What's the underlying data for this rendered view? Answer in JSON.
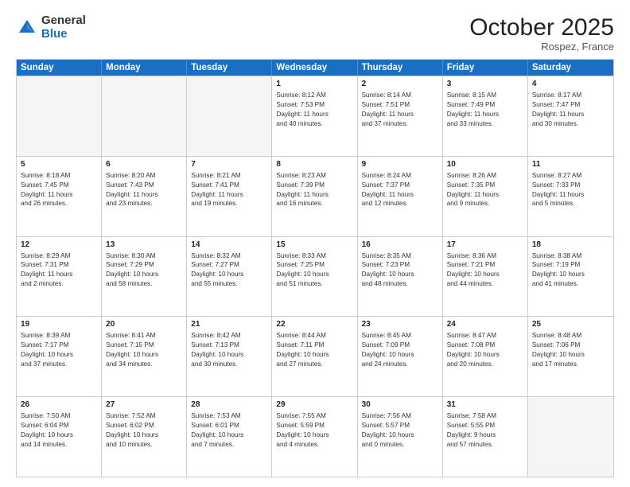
{
  "logo": {
    "general": "General",
    "blue": "Blue"
  },
  "title": "October 2025",
  "location": "Rospez, France",
  "header_days": [
    "Sunday",
    "Monday",
    "Tuesday",
    "Wednesday",
    "Thursday",
    "Friday",
    "Saturday"
  ],
  "weeks": [
    [
      {
        "day": "",
        "empty": true
      },
      {
        "day": "",
        "empty": true
      },
      {
        "day": "",
        "empty": true
      },
      {
        "day": "1",
        "lines": [
          "Sunrise: 8:12 AM",
          "Sunset: 7:53 PM",
          "Daylight: 11 hours",
          "and 40 minutes."
        ]
      },
      {
        "day": "2",
        "lines": [
          "Sunrise: 8:14 AM",
          "Sunset: 7:51 PM",
          "Daylight: 11 hours",
          "and 37 minutes."
        ]
      },
      {
        "day": "3",
        "lines": [
          "Sunrise: 8:15 AM",
          "Sunset: 7:49 PM",
          "Daylight: 11 hours",
          "and 33 minutes."
        ]
      },
      {
        "day": "4",
        "lines": [
          "Sunrise: 8:17 AM",
          "Sunset: 7:47 PM",
          "Daylight: 11 hours",
          "and 30 minutes."
        ]
      }
    ],
    [
      {
        "day": "5",
        "lines": [
          "Sunrise: 8:18 AM",
          "Sunset: 7:45 PM",
          "Daylight: 11 hours",
          "and 26 minutes."
        ]
      },
      {
        "day": "6",
        "lines": [
          "Sunrise: 8:20 AM",
          "Sunset: 7:43 PM",
          "Daylight: 11 hours",
          "and 23 minutes."
        ]
      },
      {
        "day": "7",
        "lines": [
          "Sunrise: 8:21 AM",
          "Sunset: 7:41 PM",
          "Daylight: 11 hours",
          "and 19 minutes."
        ]
      },
      {
        "day": "8",
        "lines": [
          "Sunrise: 8:23 AM",
          "Sunset: 7:39 PM",
          "Daylight: 11 hours",
          "and 16 minutes."
        ]
      },
      {
        "day": "9",
        "lines": [
          "Sunrise: 8:24 AM",
          "Sunset: 7:37 PM",
          "Daylight: 11 hours",
          "and 12 minutes."
        ]
      },
      {
        "day": "10",
        "lines": [
          "Sunrise: 8:26 AM",
          "Sunset: 7:35 PM",
          "Daylight: 11 hours",
          "and 9 minutes."
        ]
      },
      {
        "day": "11",
        "lines": [
          "Sunrise: 8:27 AM",
          "Sunset: 7:33 PM",
          "Daylight: 11 hours",
          "and 5 minutes."
        ]
      }
    ],
    [
      {
        "day": "12",
        "lines": [
          "Sunrise: 8:29 AM",
          "Sunset: 7:31 PM",
          "Daylight: 11 hours",
          "and 2 minutes."
        ]
      },
      {
        "day": "13",
        "lines": [
          "Sunrise: 8:30 AM",
          "Sunset: 7:29 PM",
          "Daylight: 10 hours",
          "and 58 minutes."
        ]
      },
      {
        "day": "14",
        "lines": [
          "Sunrise: 8:32 AM",
          "Sunset: 7:27 PM",
          "Daylight: 10 hours",
          "and 55 minutes."
        ]
      },
      {
        "day": "15",
        "lines": [
          "Sunrise: 8:33 AM",
          "Sunset: 7:25 PM",
          "Daylight: 10 hours",
          "and 51 minutes."
        ]
      },
      {
        "day": "16",
        "lines": [
          "Sunrise: 8:35 AM",
          "Sunset: 7:23 PM",
          "Daylight: 10 hours",
          "and 48 minutes."
        ]
      },
      {
        "day": "17",
        "lines": [
          "Sunrise: 8:36 AM",
          "Sunset: 7:21 PM",
          "Daylight: 10 hours",
          "and 44 minutes."
        ]
      },
      {
        "day": "18",
        "lines": [
          "Sunrise: 8:38 AM",
          "Sunset: 7:19 PM",
          "Daylight: 10 hours",
          "and 41 minutes."
        ]
      }
    ],
    [
      {
        "day": "19",
        "lines": [
          "Sunrise: 8:39 AM",
          "Sunset: 7:17 PM",
          "Daylight: 10 hours",
          "and 37 minutes."
        ]
      },
      {
        "day": "20",
        "lines": [
          "Sunrise: 8:41 AM",
          "Sunset: 7:15 PM",
          "Daylight: 10 hours",
          "and 34 minutes."
        ]
      },
      {
        "day": "21",
        "lines": [
          "Sunrise: 8:42 AM",
          "Sunset: 7:13 PM",
          "Daylight: 10 hours",
          "and 30 minutes."
        ]
      },
      {
        "day": "22",
        "lines": [
          "Sunrise: 8:44 AM",
          "Sunset: 7:11 PM",
          "Daylight: 10 hours",
          "and 27 minutes."
        ]
      },
      {
        "day": "23",
        "lines": [
          "Sunrise: 8:45 AM",
          "Sunset: 7:09 PM",
          "Daylight: 10 hours",
          "and 24 minutes."
        ]
      },
      {
        "day": "24",
        "lines": [
          "Sunrise: 8:47 AM",
          "Sunset: 7:08 PM",
          "Daylight: 10 hours",
          "and 20 minutes."
        ]
      },
      {
        "day": "25",
        "lines": [
          "Sunrise: 8:48 AM",
          "Sunset: 7:06 PM",
          "Daylight: 10 hours",
          "and 17 minutes."
        ]
      }
    ],
    [
      {
        "day": "26",
        "lines": [
          "Sunrise: 7:50 AM",
          "Sunset: 6:04 PM",
          "Daylight: 10 hours",
          "and 14 minutes."
        ]
      },
      {
        "day": "27",
        "lines": [
          "Sunrise: 7:52 AM",
          "Sunset: 6:02 PM",
          "Daylight: 10 hours",
          "and 10 minutes."
        ]
      },
      {
        "day": "28",
        "lines": [
          "Sunrise: 7:53 AM",
          "Sunset: 6:01 PM",
          "Daylight: 10 hours",
          "and 7 minutes."
        ]
      },
      {
        "day": "29",
        "lines": [
          "Sunrise: 7:55 AM",
          "Sunset: 5:59 PM",
          "Daylight: 10 hours",
          "and 4 minutes."
        ]
      },
      {
        "day": "30",
        "lines": [
          "Sunrise: 7:56 AM",
          "Sunset: 5:57 PM",
          "Daylight: 10 hours",
          "and 0 minutes."
        ]
      },
      {
        "day": "31",
        "lines": [
          "Sunrise: 7:58 AM",
          "Sunset: 5:55 PM",
          "Daylight: 9 hours",
          "and 57 minutes."
        ]
      },
      {
        "day": "",
        "empty": true,
        "shaded": true
      }
    ]
  ]
}
